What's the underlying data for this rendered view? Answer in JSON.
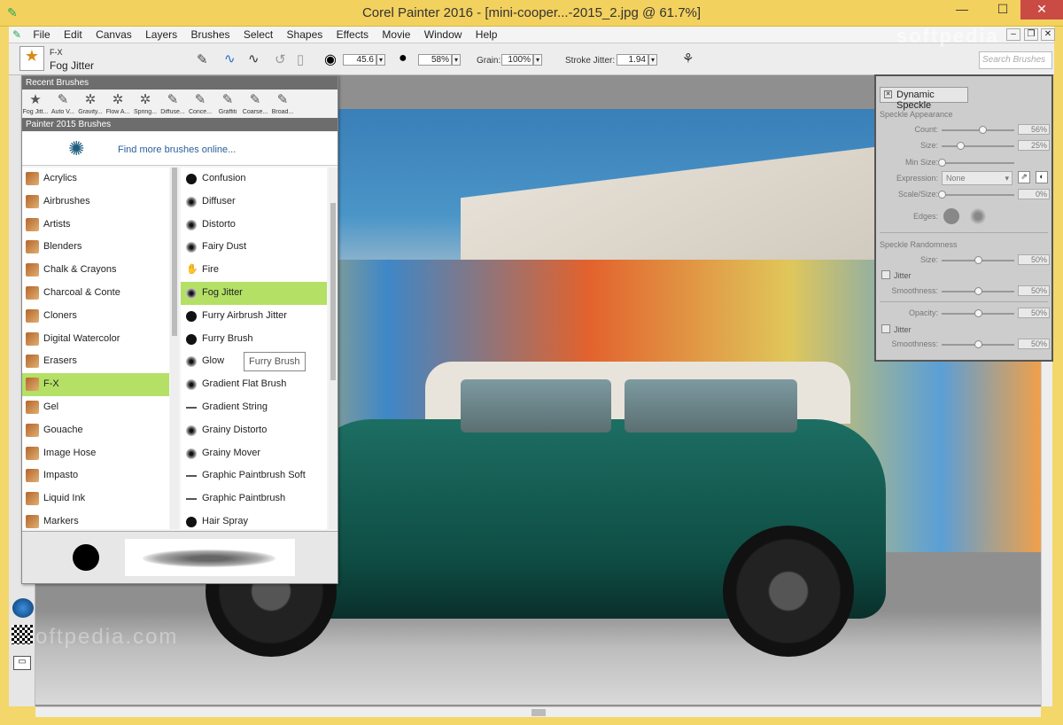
{
  "window": {
    "title": "Corel Painter 2016 - [mini-cooper...-2015_2.jpg @ 61.7%]",
    "min": "—",
    "max": "☐",
    "close": "✕"
  },
  "menu": [
    "File",
    "Edit",
    "Canvas",
    "Layers",
    "Brushes",
    "Select",
    "Shapes",
    "Effects",
    "Movie",
    "Window",
    "Help"
  ],
  "current_brush": {
    "category": "F-X",
    "name": "Fog Jitter"
  },
  "property_bar": {
    "size": "45.6",
    "opacity": "58%",
    "grain_label": "Grain:",
    "grain": "100%",
    "stroke_jitter_label": "Stroke Jitter:",
    "stroke_jitter": "1.94"
  },
  "search": {
    "placeholder": "Search Brushes"
  },
  "recent_brushes": {
    "header": "Recent Brushes",
    "items": [
      "Fog Jitt...",
      "Auto V...",
      "Gravity...",
      "Flow A...",
      "Spring...",
      "Diffuse...",
      "Conce...",
      "Graffiti",
      "Coarse...",
      "Broad..."
    ]
  },
  "library": {
    "header": "Painter 2015 Brushes",
    "find_more": "Find more brushes online...",
    "categories": [
      "Acrylics",
      "Airbrushes",
      "Artists",
      "Blenders",
      "Chalk & Crayons",
      "Charcoal & Conte",
      "Cloners",
      "Digital Watercolor",
      "Erasers",
      "F-X",
      "Gel",
      "Gouache",
      "Image Hose",
      "Impasto",
      "Liquid Ink",
      "Markers"
    ],
    "selected_category": "F-X",
    "variants": [
      "Confusion",
      "Diffuser",
      "Distorto",
      "Fairy Dust",
      "Fire",
      "Fog Jitter",
      "Furry Airbrush Jitter",
      "Furry Brush",
      "Glow",
      "Gradient Flat Brush",
      "Gradient String",
      "Grainy Distorto",
      "Grainy Mover",
      "Graphic Paintbrush Soft",
      "Graphic Paintbrush",
      "Hair Spray"
    ],
    "selected_variant": "Fog Jitter",
    "tooltip": "Furry Brush"
  },
  "dynamic_speckle": {
    "tab": "Dynamic Speckle",
    "appearance_header": "Speckle Appearance",
    "count_label": "Count:",
    "count": "56%",
    "count_level": 0.56,
    "size_label": "Size:",
    "size": "25%",
    "size_level": 0.25,
    "min_size_label": "Min Size:",
    "min_size": "0%",
    "min_size_level": 0.0,
    "expression_label": "Expression:",
    "expression": "None",
    "scale_size_label": "Scale/Size:",
    "scale_size": "0%",
    "scale_size_level": 0.0,
    "edges_label": "Edges:",
    "randomness_header": "Speckle Randomness",
    "r_size_label": "Size:",
    "r_size": "50%",
    "r_size_level": 0.5,
    "jitter_label": "Jitter",
    "smoothness_label": "Smoothness:",
    "smoothness": "50%",
    "smoothness_level": 0.5,
    "opacity_label": "Opacity:",
    "opacity": "50%",
    "opacity_level": 0.5,
    "jitter2_label": "Jitter",
    "smoothness2_label": "Smoothness:",
    "smoothness2": "50%",
    "smoothness2_level": 0.5
  },
  "watermark": "softpedia",
  "canvas_watermark": "oftpedia.com"
}
